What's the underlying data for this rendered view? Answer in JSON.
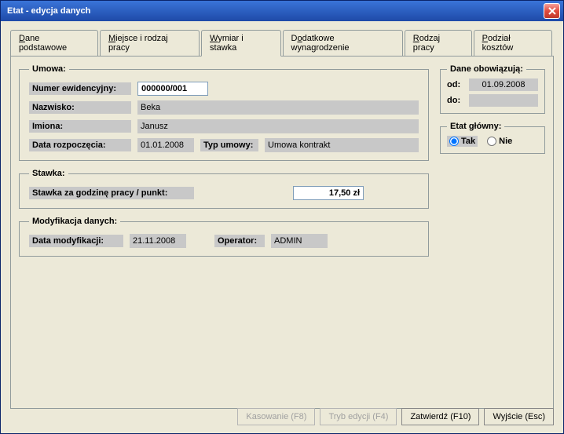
{
  "window": {
    "title": "Etat - edycja danych"
  },
  "tabs": {
    "items": [
      {
        "label": "Dane podstawowe",
        "u": "D"
      },
      {
        "label": "Miejsce i rodzaj pracy",
        "u": "M"
      },
      {
        "label": "Wymiar i stawka",
        "u": "W",
        "active": true
      },
      {
        "label": "Dodatkowe wynagrodzenie",
        "u": "o"
      },
      {
        "label": "Rodzaj pracy",
        "u": "R"
      },
      {
        "label": "Podział kosztów",
        "u": "P"
      }
    ]
  },
  "umowa": {
    "legend": "Umowa:",
    "numer_label": "Numer ewidencyjny:",
    "numer_value": "000000/001",
    "nazwisko_label": "Nazwisko:",
    "nazwisko_value": "Beka",
    "imiona_label": "Imiona:",
    "imiona_value": "Janusz",
    "data_rozp_label": "Data rozpoczęcia:",
    "data_rozp_value": "01.01.2008",
    "typ_umowy_label": "Typ umowy:",
    "typ_umowy_value": "Umowa kontrakt"
  },
  "stawka": {
    "legend": "Stawka:",
    "label": "Stawka za godzinę pracy / punkt:",
    "value": "17,50 zł"
  },
  "modyfikacja": {
    "legend": "Modyfikacja danych:",
    "data_label": "Data modyfikacji:",
    "data_value": "21.11.2008",
    "operator_label": "Operator:",
    "operator_value": "ADMIN"
  },
  "dane_obowiazuja": {
    "legend": "Dane obowiązują:",
    "od_label": "od:",
    "od_value": "01.09.2008",
    "do_label": "do:",
    "do_value": ""
  },
  "etat_glowny": {
    "legend": "Etat główny:",
    "tak": "Tak",
    "nie": "Nie",
    "selected": "Tak"
  },
  "buttons": {
    "kasowanie": "Kasowanie (F8)",
    "tryb_edycji": "Tryb edycji (F4)",
    "zatwierdz": "Zatwierdź (F10)",
    "wyjscie": "Wyjście (Esc)"
  }
}
